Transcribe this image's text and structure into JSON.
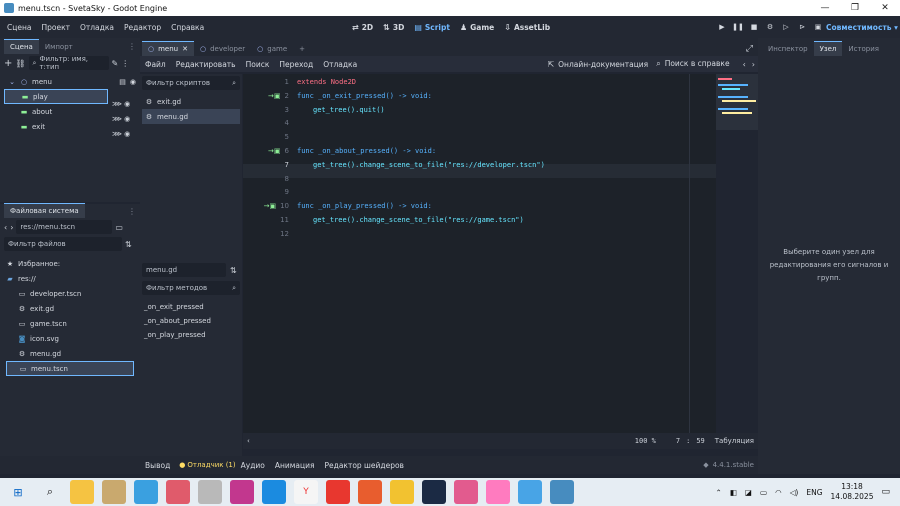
{
  "window": {
    "title": "menu.tscn - SvetaSky - Godot Engine",
    "min": "—",
    "max": "❐",
    "close": "✕"
  },
  "menubar": {
    "items": [
      "Сцена",
      "Проект",
      "Отладка",
      "Редактор",
      "Справка"
    ],
    "workspaces": [
      {
        "label": "2D",
        "icon": "2d-icon",
        "glyph": "⇄"
      },
      {
        "label": "3D",
        "icon": "3d-icon",
        "glyph": "⇅"
      },
      {
        "label": "Script",
        "icon": "script-icon",
        "glyph": "▤"
      },
      {
        "label": "Game",
        "icon": "game-icon",
        "glyph": "♟"
      },
      {
        "label": "AssetLib",
        "icon": "assetlib-icon",
        "glyph": "⇩"
      }
    ],
    "renderer": "Совместимость"
  },
  "scene_dock": {
    "tabs": [
      "Сцена",
      "Импорт"
    ],
    "filter_placeholder": "Фильтр: имя, т:тип",
    "nodes": [
      {
        "name": "menu",
        "level": 0
      },
      {
        "name": "play",
        "level": 1
      },
      {
        "name": "about",
        "level": 1
      },
      {
        "name": "exit",
        "level": 1
      }
    ]
  },
  "filesystem_dock": {
    "tab": "Файловая система",
    "path": "res://menu.tscn",
    "filter_placeholder": "Фильтр файлов",
    "favorites": "Избранное:",
    "root": "res://",
    "files": [
      "developer.tscn",
      "exit.gd",
      "game.tscn",
      "icon.svg",
      "menu.gd",
      "menu.tscn"
    ]
  },
  "editor_tabs": [
    "menu",
    "developer",
    "game"
  ],
  "script_menu": {
    "items": [
      "Файл",
      "Редактировать",
      "Поиск",
      "Переход",
      "Отладка"
    ],
    "online_docs": "Онлайн-документация",
    "search_help": "Поиск в справке"
  },
  "script_list": {
    "filter_placeholder": "Фильтр скриптов",
    "scripts": [
      "exit.gd",
      "menu.gd"
    ],
    "current": "menu.gd",
    "method_filter": "Фильтр методов",
    "methods": [
      "_on_exit_pressed",
      "_on_about_pressed",
      "_on_play_pressed"
    ]
  },
  "code": {
    "lines": [
      {
        "n": "1",
        "t": "extends Node2D"
      },
      {
        "n": "2",
        "t": "func _on_exit_pressed() -> void:"
      },
      {
        "n": "3",
        "t": "get_tree().quit()"
      },
      {
        "n": "4",
        "t": ""
      },
      {
        "n": "5",
        "t": ""
      },
      {
        "n": "6",
        "t": "func _on_about_pressed() -> void:"
      },
      {
        "n": "7",
        "t": "get_tree().change_scene_to_file(\"res://developer.tscn\")"
      },
      {
        "n": "8",
        "t": ""
      },
      {
        "n": "9",
        "t": ""
      },
      {
        "n": "10",
        "t": "func _on_play_pressed() -> void:"
      },
      {
        "n": "11",
        "t": "get_tree().change_scene_to_file(\"res://game.tscn\")"
      },
      {
        "n": "12",
        "t": ""
      }
    ]
  },
  "status": {
    "zoom": "100 %",
    "line": "7",
    "col": "59",
    "indent": "Табуляция"
  },
  "bottom_panel": {
    "items": [
      "Вывод",
      "Отладчик (1)",
      "Аудио",
      "Анимация",
      "Редактор шейдеров"
    ],
    "version": "4.4.1.stable"
  },
  "inspector": {
    "tabs": [
      "Инспектор",
      "Узел",
      "История"
    ],
    "message": "Выберите один узел для редактирования его сигналов и групп."
  },
  "taskbar": {
    "lang": "ENG",
    "time": "13:18",
    "date": "14.08.2025"
  },
  "colors": {
    "accent": "#70b8ff",
    "bg": "#202531",
    "panel": "#282d3a"
  }
}
